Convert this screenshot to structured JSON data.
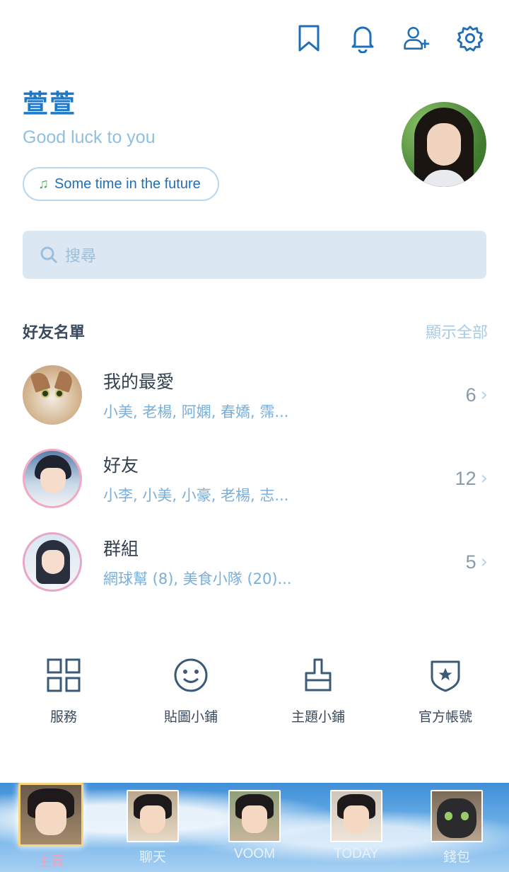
{
  "header": {
    "icons": [
      "bookmark-icon",
      "bell-icon",
      "add-friend-icon",
      "gear-icon"
    ]
  },
  "profile": {
    "name": "萱萱",
    "status": "Good luck to you",
    "music": "Some time in the future"
  },
  "search": {
    "placeholder": "搜尋"
  },
  "friends_section": {
    "title": "好友名單",
    "show_all": "顯示全部",
    "rows": [
      {
        "title": "我的最愛",
        "subtitle": "小美, 老楊, 阿嫻, 春嬌, 霈...",
        "count": "6"
      },
      {
        "title": "好友",
        "subtitle": "小李, 小美, 小豪, 老楊, 志...",
        "count": "12"
      },
      {
        "title": "群組",
        "subtitle": "網球幫 (8), 美食小隊 (20)...",
        "count": "5"
      }
    ]
  },
  "services": [
    {
      "label": "服務",
      "icon": "grid-icon"
    },
    {
      "label": "貼圖小鋪",
      "icon": "smiley-icon"
    },
    {
      "label": "主題小鋪",
      "icon": "brush-icon"
    },
    {
      "label": "官方帳號",
      "icon": "shield-star-icon"
    }
  ],
  "bottom_nav": [
    {
      "label": "主頁",
      "active": true
    },
    {
      "label": "聊天",
      "active": false
    },
    {
      "label": "VOOM",
      "active": false
    },
    {
      "label": "TODAY",
      "active": false
    },
    {
      "label": "錢包",
      "active": false
    }
  ],
  "colors": {
    "accent": "#1e78c8",
    "status_text": "#8fbfe3",
    "search_bg": "#dbe8f4",
    "active_tab_label": "#f1a0c2"
  }
}
